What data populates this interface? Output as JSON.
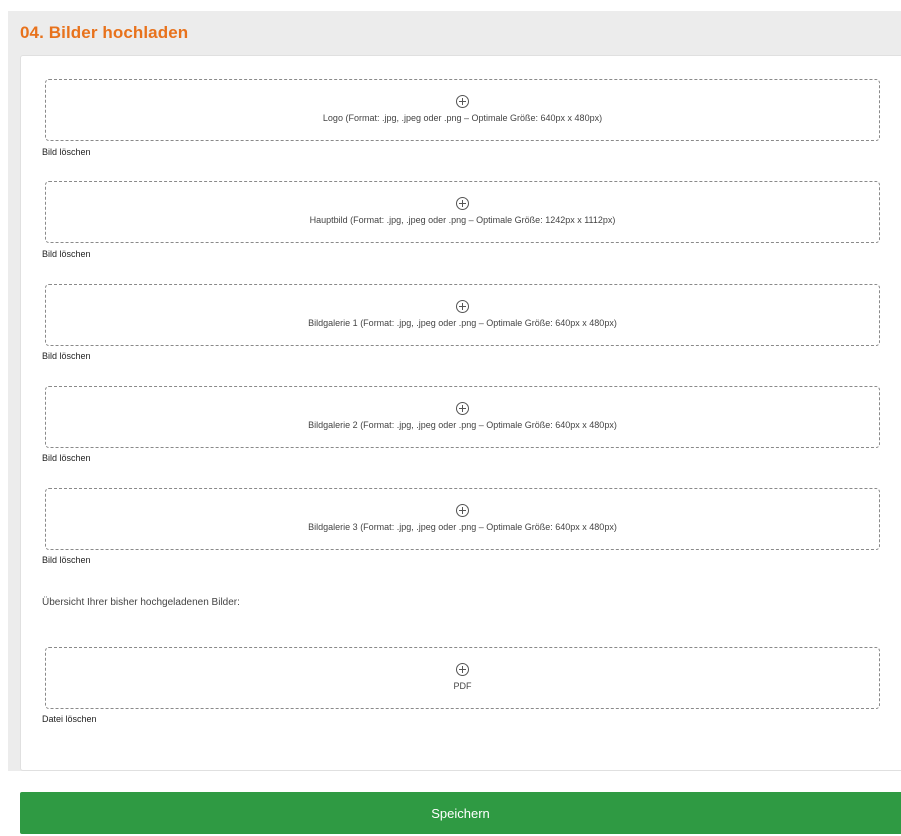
{
  "section": {
    "title": "04. Bilder hochladen"
  },
  "uploads": [
    {
      "label": "Logo (Format: .jpg, .jpeg oder .png – Optimale Größe: 640px x 480px)",
      "delete_label": "Bild löschen",
      "icon": "plus-circle-icon"
    },
    {
      "label": "Hauptbild (Format: .jpg, .jpeg oder .png – Optimale Größe: 1242px x 1112px)",
      "delete_label": "Bild löschen",
      "icon": "plus-circle-icon"
    },
    {
      "label": "Bildgalerie 1 (Format: .jpg, .jpeg oder .png – Optimale Größe: 640px x 480px)",
      "delete_label": "Bild löschen",
      "icon": "plus-circle-icon"
    },
    {
      "label": "Bildgalerie 2 (Format: .jpg, .jpeg oder .png – Optimale Größe: 640px x 480px)",
      "delete_label": "Bild löschen",
      "icon": "plus-circle-icon"
    },
    {
      "label": "Bildgalerie 3 (Format: .jpg, .jpeg oder .png – Optimale Größe: 640px x 480px)",
      "delete_label": "Bild löschen",
      "icon": "plus-circle-icon"
    }
  ],
  "overview_text": "Übersicht Ihrer bisher hochgeladenen Bilder:",
  "pdf_upload": {
    "label": "PDF",
    "delete_label": "Datei löschen",
    "icon": "plus-circle-icon"
  },
  "save_button": {
    "label": "Speichern"
  },
  "colors": {
    "title_accent": "#e8721c",
    "save_button_bg": "#2f9a43",
    "outer_bg": "#ececec",
    "dropzone_border": "#8a8a8a"
  }
}
